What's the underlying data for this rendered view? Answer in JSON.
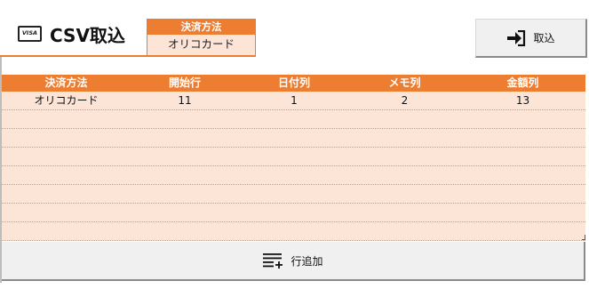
{
  "header": {
    "card_icon_text": "VISA",
    "title": "CSV取込"
  },
  "payment_method": {
    "label": "決済方法",
    "value": "オリコカード"
  },
  "import_button": {
    "label": "取込",
    "icon": "sign-in-icon"
  },
  "table": {
    "headers": [
      "決済方法",
      "開始行",
      "日付列",
      "メモ列",
      "金額列"
    ],
    "rows": [
      [
        "オリコカード",
        "11",
        "1",
        "2",
        "13"
      ],
      [
        "",
        "",
        "",
        "",
        ""
      ],
      [
        "",
        "",
        "",
        "",
        ""
      ],
      [
        "",
        "",
        "",
        "",
        ""
      ],
      [
        "",
        "",
        "",
        "",
        ""
      ],
      [
        "",
        "",
        "",
        "",
        ""
      ],
      [
        "",
        "",
        "",
        "",
        ""
      ],
      [
        "",
        "",
        "",
        "",
        ""
      ]
    ]
  },
  "add_row_button": {
    "label": "行追加",
    "icon": "list-add-icon"
  },
  "colors": {
    "accent": "#ed7d31",
    "row_fill": "#fce4d6",
    "button_fill": "#f0f0f0"
  }
}
